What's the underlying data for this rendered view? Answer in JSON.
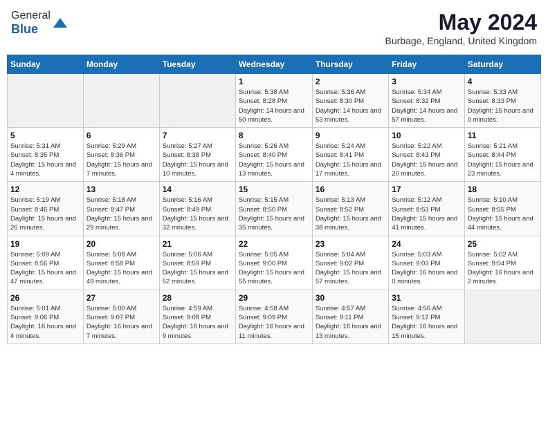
{
  "header": {
    "logo_line1": "General",
    "logo_line2": "Blue",
    "month_title": "May 2024",
    "location": "Burbage, England, United Kingdom"
  },
  "weekdays": [
    "Sunday",
    "Monday",
    "Tuesday",
    "Wednesday",
    "Thursday",
    "Friday",
    "Saturday"
  ],
  "weeks": [
    [
      {
        "day": "",
        "sunrise": "",
        "sunset": "",
        "daylight": ""
      },
      {
        "day": "",
        "sunrise": "",
        "sunset": "",
        "daylight": ""
      },
      {
        "day": "",
        "sunrise": "",
        "sunset": "",
        "daylight": ""
      },
      {
        "day": "1",
        "sunrise": "5:38 AM",
        "sunset": "8:28 PM",
        "daylight": "14 hours and 50 minutes."
      },
      {
        "day": "2",
        "sunrise": "5:36 AM",
        "sunset": "8:30 PM",
        "daylight": "14 hours and 53 minutes."
      },
      {
        "day": "3",
        "sunrise": "5:34 AM",
        "sunset": "8:32 PM",
        "daylight": "14 hours and 57 minutes."
      },
      {
        "day": "4",
        "sunrise": "5:33 AM",
        "sunset": "8:33 PM",
        "daylight": "15 hours and 0 minutes."
      }
    ],
    [
      {
        "day": "5",
        "sunrise": "5:31 AM",
        "sunset": "8:35 PM",
        "daylight": "15 hours and 4 minutes."
      },
      {
        "day": "6",
        "sunrise": "5:29 AM",
        "sunset": "8:36 PM",
        "daylight": "15 hours and 7 minutes."
      },
      {
        "day": "7",
        "sunrise": "5:27 AM",
        "sunset": "8:38 PM",
        "daylight": "15 hours and 10 minutes."
      },
      {
        "day": "8",
        "sunrise": "5:26 AM",
        "sunset": "8:40 PM",
        "daylight": "15 hours and 13 minutes."
      },
      {
        "day": "9",
        "sunrise": "5:24 AM",
        "sunset": "8:41 PM",
        "daylight": "15 hours and 17 minutes."
      },
      {
        "day": "10",
        "sunrise": "5:22 AM",
        "sunset": "8:43 PM",
        "daylight": "15 hours and 20 minutes."
      },
      {
        "day": "11",
        "sunrise": "5:21 AM",
        "sunset": "8:44 PM",
        "daylight": "15 hours and 23 minutes."
      }
    ],
    [
      {
        "day": "12",
        "sunrise": "5:19 AM",
        "sunset": "8:46 PM",
        "daylight": "15 hours and 26 minutes."
      },
      {
        "day": "13",
        "sunrise": "5:18 AM",
        "sunset": "8:47 PM",
        "daylight": "15 hours and 29 minutes."
      },
      {
        "day": "14",
        "sunrise": "5:16 AM",
        "sunset": "8:49 PM",
        "daylight": "15 hours and 32 minutes."
      },
      {
        "day": "15",
        "sunrise": "5:15 AM",
        "sunset": "8:50 PM",
        "daylight": "15 hours and 35 minutes."
      },
      {
        "day": "16",
        "sunrise": "5:13 AM",
        "sunset": "8:52 PM",
        "daylight": "15 hours and 38 minutes."
      },
      {
        "day": "17",
        "sunrise": "5:12 AM",
        "sunset": "8:53 PM",
        "daylight": "15 hours and 41 minutes."
      },
      {
        "day": "18",
        "sunrise": "5:10 AM",
        "sunset": "8:55 PM",
        "daylight": "15 hours and 44 minutes."
      }
    ],
    [
      {
        "day": "19",
        "sunrise": "5:09 AM",
        "sunset": "8:56 PM",
        "daylight": "15 hours and 47 minutes."
      },
      {
        "day": "20",
        "sunrise": "5:08 AM",
        "sunset": "8:58 PM",
        "daylight": "15 hours and 49 minutes."
      },
      {
        "day": "21",
        "sunrise": "5:06 AM",
        "sunset": "8:59 PM",
        "daylight": "15 hours and 52 minutes."
      },
      {
        "day": "22",
        "sunrise": "5:05 AM",
        "sunset": "9:00 PM",
        "daylight": "15 hours and 55 minutes."
      },
      {
        "day": "23",
        "sunrise": "5:04 AM",
        "sunset": "9:02 PM",
        "daylight": "15 hours and 57 minutes."
      },
      {
        "day": "24",
        "sunrise": "5:03 AM",
        "sunset": "9:03 PM",
        "daylight": "16 hours and 0 minutes."
      },
      {
        "day": "25",
        "sunrise": "5:02 AM",
        "sunset": "9:04 PM",
        "daylight": "16 hours and 2 minutes."
      }
    ],
    [
      {
        "day": "26",
        "sunrise": "5:01 AM",
        "sunset": "9:06 PM",
        "daylight": "16 hours and 4 minutes."
      },
      {
        "day": "27",
        "sunrise": "5:00 AM",
        "sunset": "9:07 PM",
        "daylight": "16 hours and 7 minutes."
      },
      {
        "day": "28",
        "sunrise": "4:59 AM",
        "sunset": "9:08 PM",
        "daylight": "16 hours and 9 minutes."
      },
      {
        "day": "29",
        "sunrise": "4:58 AM",
        "sunset": "9:09 PM",
        "daylight": "16 hours and 11 minutes."
      },
      {
        "day": "30",
        "sunrise": "4:57 AM",
        "sunset": "9:11 PM",
        "daylight": "16 hours and 13 minutes."
      },
      {
        "day": "31",
        "sunrise": "4:56 AM",
        "sunset": "9:12 PM",
        "daylight": "16 hours and 15 minutes."
      },
      {
        "day": "",
        "sunrise": "",
        "sunset": "",
        "daylight": ""
      }
    ]
  ]
}
